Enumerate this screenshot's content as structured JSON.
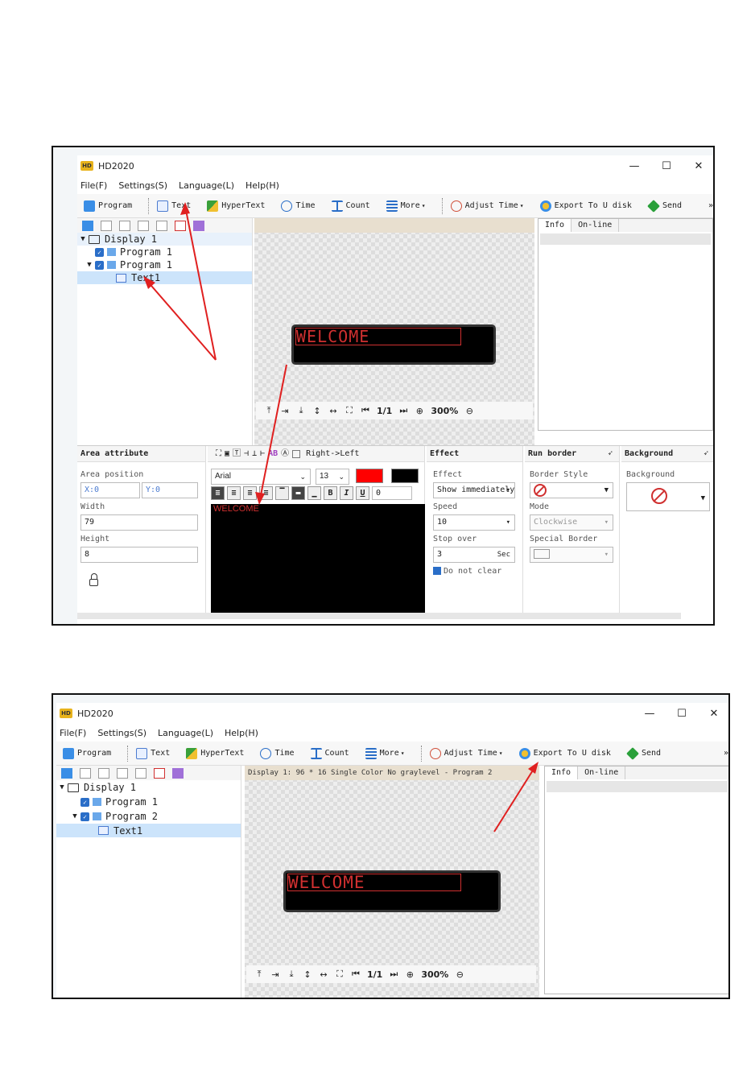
{
  "app": {
    "title": "HD2020"
  },
  "menu": [
    "File(F)",
    "Settings(S)",
    "Language(L)",
    "Help(H)"
  ],
  "toolbar": {
    "program": "Program",
    "text": "Text",
    "hypertext": "HyperText",
    "time": "Time",
    "count": "Count",
    "more": "More",
    "adjust_time": "Adjust Time",
    "export": "Export To U disk",
    "send": "Send",
    "overflow": "»"
  },
  "tree": {
    "display": "Display 1",
    "screen1": {
      "program_a": "Program 1",
      "program_b": "Program 1",
      "text": "Text1"
    },
    "screen2": {
      "program_a": "Program 1",
      "program_b": "Program 2",
      "text": "Text1"
    }
  },
  "preview": {
    "led_text": "WELCOME",
    "info_bar_2": "Display 1: 96 * 16 Single Color No graylevel - Program 2",
    "page": "1/1",
    "zoom": "300%"
  },
  "tabs": {
    "info": "Info",
    "online": "On-line"
  },
  "area": {
    "title": "Area attribute",
    "position_label": "Area position",
    "x": "X:0",
    "y": "Y:0",
    "width_label": "Width",
    "width": "79",
    "height_label": "Height",
    "height": "8"
  },
  "text_edit": {
    "direction": "Right->Left",
    "font": "Arial",
    "size": "13",
    "spacing": "0",
    "content": "WELCOME",
    "text_color": "#ff0000",
    "bg_color": "#000000",
    "bold": "B",
    "italic": "I",
    "underline": "U",
    "ab": "AB"
  },
  "effect": {
    "title": "Effect",
    "effect_label": "Effect",
    "effect_value": "Show immediately",
    "speed_label": "Speed",
    "speed_value": "10",
    "stop_label": "Stop over",
    "stop_value": "3",
    "stop_unit": "Sec",
    "no_clear": "Do not clear"
  },
  "border": {
    "title": "Run border",
    "style_label": "Border Style",
    "mode_label": "Mode",
    "mode_value": "Clockwise",
    "special_label": "Special Border"
  },
  "background": {
    "title": "Background",
    "label": "Background"
  },
  "colors": {
    "arrow": "#e02020",
    "led": "#d03030",
    "accent": "#2a6ec8"
  }
}
